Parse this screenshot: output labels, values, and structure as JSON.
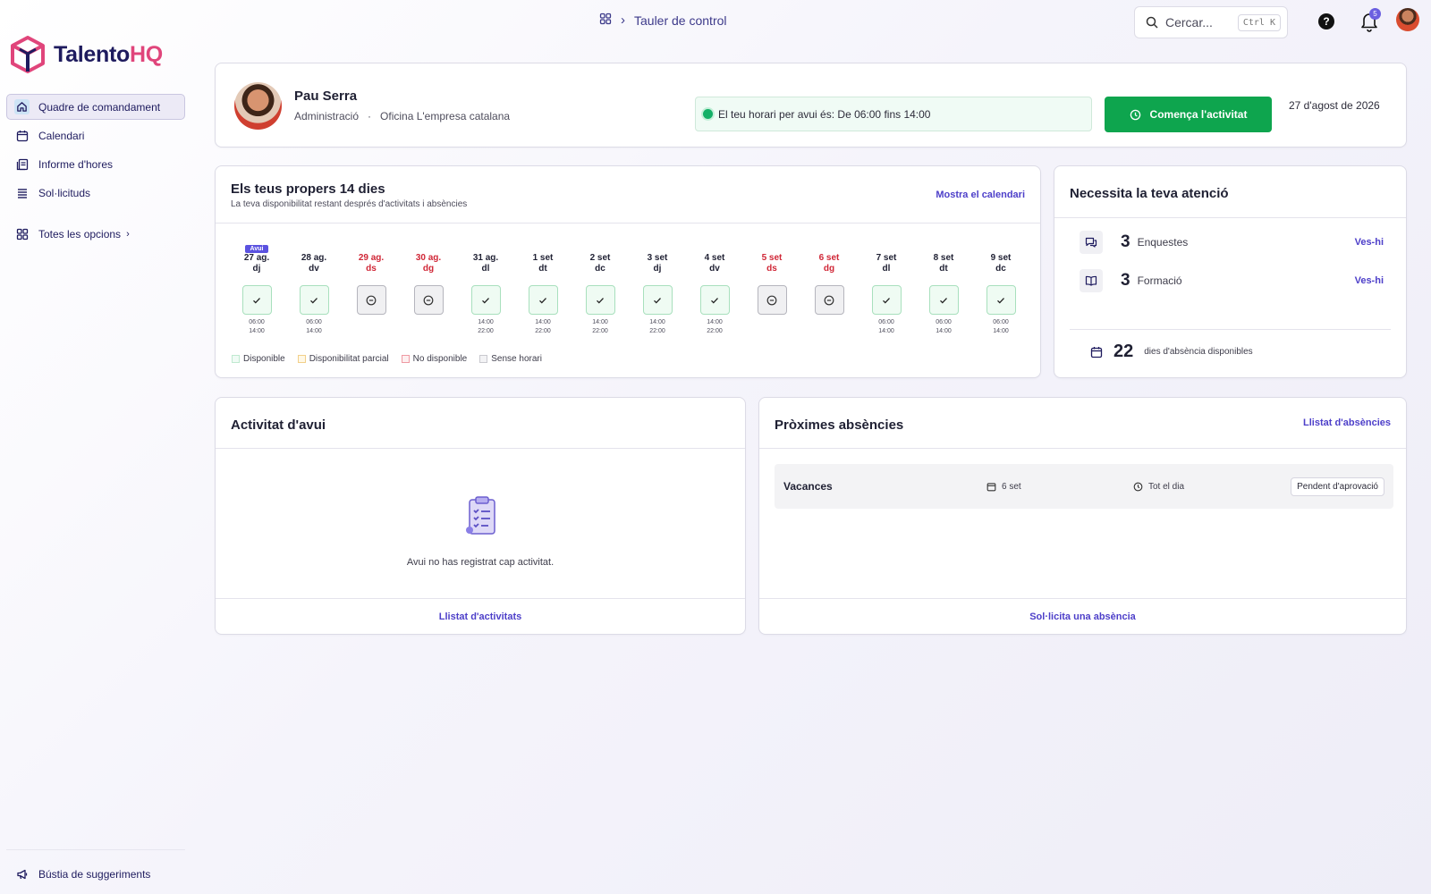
{
  "brand": {
    "name_main": "Talento",
    "name_accent": "HQ"
  },
  "sidebar": {
    "items": [
      {
        "label": "Quadre de comandament",
        "icon": "home-icon",
        "active": true
      },
      {
        "label": "Calendari",
        "icon": "calendar-icon"
      },
      {
        "label": "Informe d'hores",
        "icon": "report-icon"
      },
      {
        "label": "Sol·licituds",
        "icon": "list-icon"
      }
    ],
    "all_options": "Totes les opcions",
    "feedback": "Bústia de suggeriments"
  },
  "topbar": {
    "breadcrumb": "Tauler de control",
    "search_placeholder": "Cercar...",
    "search_shortcut": "Ctrl K",
    "help": "?",
    "notifications_count": "5"
  },
  "profile": {
    "name": "Pau Serra",
    "department": "Administració",
    "separator": "·",
    "office": "Oficina L'empresa catalana",
    "schedule_text": "El teu horari per avui és: De 06:00 fins 14:00",
    "start_button": "Comença l'activitat",
    "date": "27 d'agost de 2026"
  },
  "next_days": {
    "title": "Els teus propers 14 dies",
    "subtitle": "La teva disponibilitat restant després d'activitats i absències",
    "link": "Mostra el calendari",
    "today_badge": "Avui",
    "days": [
      {
        "date": "27 ag.",
        "dow": "dj",
        "status": "available",
        "start": "06:00",
        "end": "14:00",
        "today": true
      },
      {
        "date": "28 ag.",
        "dow": "dv",
        "status": "available",
        "start": "06:00",
        "end": "14:00"
      },
      {
        "date": "29 ag.",
        "dow": "ds",
        "status": "none",
        "weekend": true
      },
      {
        "date": "30 ag.",
        "dow": "dg",
        "status": "none",
        "weekend": true
      },
      {
        "date": "31 ag.",
        "dow": "dl",
        "status": "available",
        "start": "14:00",
        "end": "22:00"
      },
      {
        "date": "1 set",
        "dow": "dt",
        "status": "available",
        "start": "14:00",
        "end": "22:00"
      },
      {
        "date": "2 set",
        "dow": "dc",
        "status": "available",
        "start": "14:00",
        "end": "22:00"
      },
      {
        "date": "3 set",
        "dow": "dj",
        "status": "available",
        "start": "14:00",
        "end": "22:00"
      },
      {
        "date": "4 set",
        "dow": "dv",
        "status": "available",
        "start": "14:00",
        "end": "22:00"
      },
      {
        "date": "5 set",
        "dow": "ds",
        "status": "none",
        "weekend": true
      },
      {
        "date": "6 set",
        "dow": "dg",
        "status": "none",
        "weekend": true
      },
      {
        "date": "7 set",
        "dow": "dl",
        "status": "available",
        "start": "06:00",
        "end": "14:00"
      },
      {
        "date": "8 set",
        "dow": "dt",
        "status": "available",
        "start": "06:00",
        "end": "14:00"
      },
      {
        "date": "9 set",
        "dow": "dc",
        "status": "available",
        "start": "06:00",
        "end": "14:00"
      }
    ],
    "legend": [
      {
        "label": "Disponible",
        "color": "#bfe9d0",
        "fill": "#f0fbf5"
      },
      {
        "label": "Disponibilitat parcial",
        "color": "#f2d08a",
        "fill": "#fff8e6"
      },
      {
        "label": "No disponible",
        "color": "#ef9aa3",
        "fill": "#fdeff0"
      },
      {
        "label": "Sense horari",
        "color": "#c9c9cf",
        "fill": "#f3f3f5"
      }
    ]
  },
  "attention": {
    "title": "Necessita la teva atenció",
    "items": [
      {
        "count": "3",
        "label": "Enquestes",
        "action": "Ves-hi",
        "icon": "chat-icon"
      },
      {
        "count": "3",
        "label": "Formació",
        "action": "Ves-hi",
        "icon": "book-icon"
      }
    ],
    "absence_days": "22",
    "absence_label": "dies d'absència disponibles"
  },
  "activity": {
    "title": "Activitat d'avui",
    "empty_text": "Avui no has registrat cap activitat.",
    "footer_link": "Llistat d'activitats"
  },
  "absences": {
    "title": "Pròximes absències",
    "link": "Llistat d'absències",
    "rows": [
      {
        "type": "Vacances",
        "date": "6 set",
        "duration": "Tot el dia",
        "status": "Pendent d'aprovació"
      }
    ],
    "footer_link": "Sol·licita una absència"
  },
  "colors": {
    "accent": "#4d3fc9",
    "primary_green": "#0ea54e",
    "weekend_red": "#d02636",
    "brand_pink": "#e0457b",
    "brand_navy": "#1e1b5e"
  }
}
